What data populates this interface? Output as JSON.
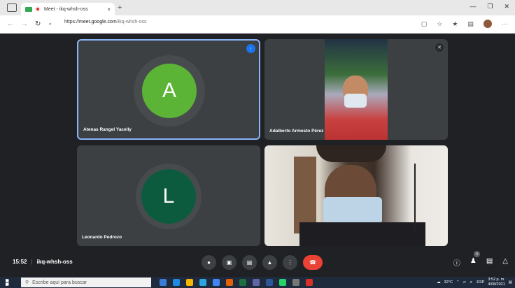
{
  "browser": {
    "tab_title": "Meet - ikq-whsh-oss",
    "tab_close": "×",
    "new_tab": "+",
    "url_scheme": "https://",
    "url_host": "meet.google.com",
    "url_path": "/ikq-whsh-oss"
  },
  "participants": [
    {
      "name": "Atenas Rangel Yacelly",
      "initial": "A",
      "color": "#5bb435"
    },
    {
      "name": "Adalberto Armesto Pérez"
    },
    {
      "name": "Leonardo Pedrozo",
      "initial": "L",
      "color": "#0d5b3f"
    },
    {
      "name": ""
    }
  ],
  "meeting": {
    "time": "15:52",
    "separator": "|",
    "code": "ikq-whsh-oss",
    "people_count": "4"
  },
  "taskbar": {
    "search_placeholder": "Escribe aquí para buscar",
    "temperature": "32°C",
    "language": "ESP",
    "clock_time": "3:52 p. m.",
    "clock_date": "4/08/2021"
  },
  "colors": {
    "accent": "#8ab4f8",
    "end_call": "#ea4335",
    "speaking": "#1a73e8"
  }
}
